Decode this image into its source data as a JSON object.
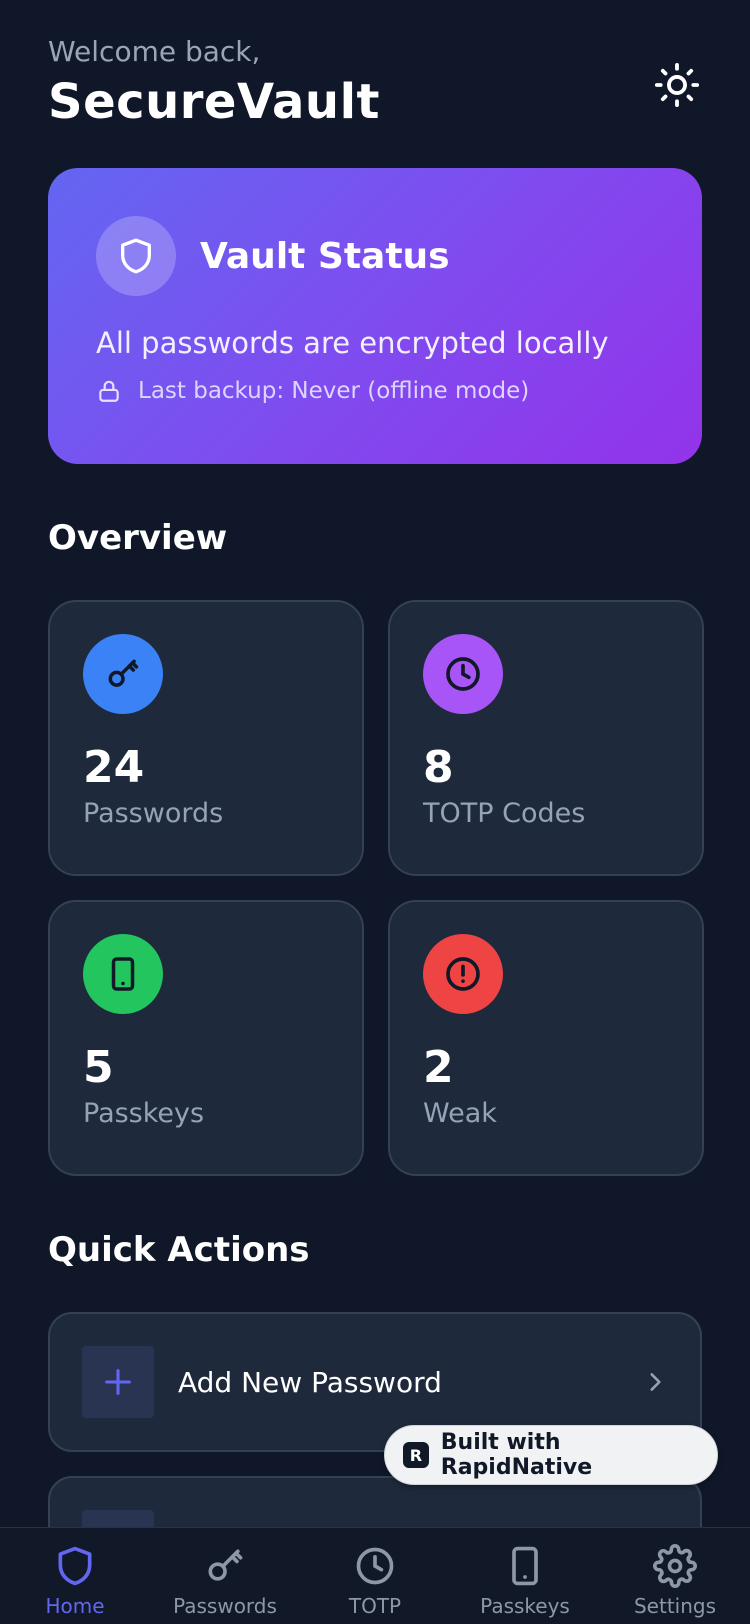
{
  "header": {
    "greeting": "Welcome back,",
    "app_name": "SecureVault",
    "theme_icon": "sun-icon"
  },
  "status_card": {
    "title": "Vault Status",
    "description": "All passwords are encrypted locally",
    "backup_text": "Last backup: Never (offline mode)",
    "gradient_from": "#6366f1",
    "gradient_to": "#9333ea"
  },
  "overview": {
    "title": "Overview",
    "stats": [
      {
        "value": "24",
        "label": "Passwords",
        "icon": "key-icon",
        "color": "#3b82f6"
      },
      {
        "value": "8",
        "label": "TOTP Codes",
        "icon": "clock-icon",
        "color": "#a855f7"
      },
      {
        "value": "5",
        "label": "Passkeys",
        "icon": "smartphone-icon",
        "color": "#22c55e"
      },
      {
        "value": "2",
        "label": "Weak",
        "icon": "alert-circle-icon",
        "color": "#ef4444"
      }
    ]
  },
  "quick_actions": {
    "title": "Quick Actions",
    "items": [
      {
        "label": "Add New Password",
        "icon": "plus-icon"
      },
      {
        "label": "",
        "icon": ""
      }
    ]
  },
  "badge": {
    "text": "Built with RapidNative"
  },
  "tabbar": {
    "active": "Home",
    "accent": "#6366f1",
    "tabs": [
      {
        "label": "Home",
        "icon": "shield-icon"
      },
      {
        "label": "Passwords",
        "icon": "key-icon"
      },
      {
        "label": "TOTP",
        "icon": "clock-icon"
      },
      {
        "label": "Passkeys",
        "icon": "smartphone-icon"
      },
      {
        "label": "Settings",
        "icon": "gear-icon"
      }
    ]
  }
}
